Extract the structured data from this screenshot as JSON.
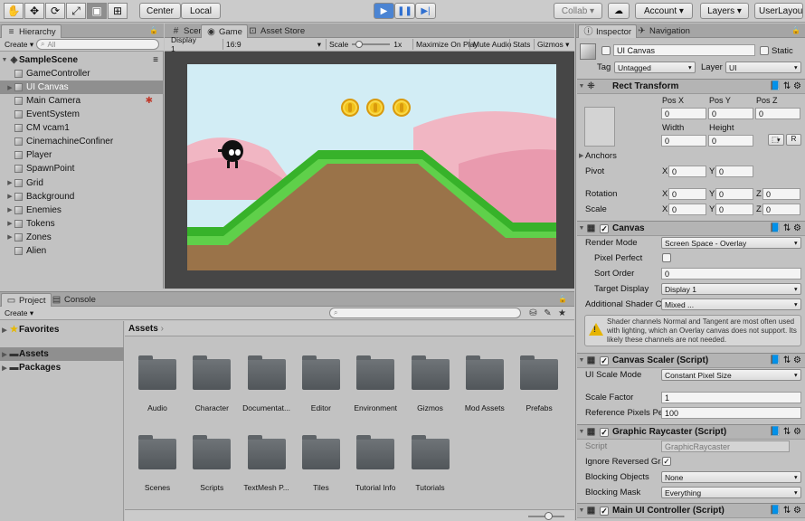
{
  "toolbar": {
    "tools": [
      "hand-icon",
      "move-icon",
      "rotate-icon",
      "scale-icon",
      "rect-tool-icon",
      "transform-icon"
    ],
    "pivot_label": "Center",
    "space_label": "Local",
    "play_icon": "play-icon",
    "pause_icon": "pause-icon",
    "step_icon": "step-icon",
    "collab_label": "Collab",
    "cloud_icon": "cloud-icon",
    "account_label": "Account",
    "layers_label": "Layers",
    "layout_label": "UserLayou"
  },
  "hierarchy": {
    "tab_label": "Hierarchy",
    "create_label": "Create",
    "search_placeholder": "All",
    "scene_name": "SampleScene",
    "items": [
      {
        "label": "GameController"
      },
      {
        "label": "UI Canvas"
      },
      {
        "label": "Main Camera"
      },
      {
        "label": "EventSystem"
      },
      {
        "label": "CM vcam1"
      },
      {
        "label": "CinemachineConfiner"
      },
      {
        "label": "Player"
      },
      {
        "label": "SpawnPoint"
      },
      {
        "label": "Grid"
      },
      {
        "label": "Background"
      },
      {
        "label": "Enemies"
      },
      {
        "label": "Tokens"
      },
      {
        "label": "Zones"
      },
      {
        "label": "Alien"
      }
    ]
  },
  "game_view": {
    "tabs": [
      "Scene",
      "Game",
      "Asset Store"
    ],
    "display_label": "Display 1",
    "aspect_label": "16:9",
    "scale_label": "Scale",
    "scale_value": "1x",
    "maximize_label": "Maximize On Play",
    "mute_label": "Mute Audio",
    "stats_label": "Stats",
    "gizmos_label": "Gizmos"
  },
  "project": {
    "tabs": [
      "Project",
      "Console"
    ],
    "create_label": "Create",
    "favorites_label": "Favorites",
    "assets_label": "Assets",
    "packages_label": "Packages",
    "breadcrumb": "Assets",
    "folders": [
      "Audio",
      "Character",
      "Documentat...",
      "Editor",
      "Environment",
      "Gizmos",
      "Mod Assets",
      "Prefabs",
      "Scenes",
      "Scripts",
      "TextMesh P...",
      "Tiles",
      "Tutorial Info",
      "Tutorials"
    ]
  },
  "inspector": {
    "tabs": [
      "Inspector",
      "Navigation"
    ],
    "object_name": "UI Canvas",
    "static_label": "Static",
    "tag_label": "Tag",
    "tag_value": "Untagged",
    "layer_label": "Layer",
    "layer_value": "UI",
    "rect_transform": {
      "title": "Rect Transform",
      "posx_label": "Pos X",
      "posy_label": "Pos Y",
      "posz_label": "Pos Z",
      "posx": "0",
      "posy": "0",
      "posz": "0",
      "width_label": "Width",
      "height_label": "Height",
      "width": "0",
      "height": "0",
      "r_label": "R",
      "anchors_label": "Anchors",
      "pivot_label": "Pivot",
      "pivot_x": "0",
      "pivot_y": "0",
      "rotation_label": "Rotation",
      "rot_x": "0",
      "rot_y": "0",
      "rot_z": "0",
      "scale_label": "Scale",
      "scale_x": "0",
      "scale_y": "0",
      "scale_z": "0"
    },
    "canvas": {
      "title": "Canvas",
      "render_mode_label": "Render Mode",
      "render_mode": "Screen Space - Overlay",
      "pixel_perfect_label": "Pixel Perfect",
      "sort_order_label": "Sort Order",
      "sort_order": "0",
      "target_display_label": "Target Display",
      "target_display": "Display 1",
      "shader_label": "Additional Shader Cl",
      "shader_value": "Mixed ...",
      "warning": "Shader channels Normal and Tangent are most often used with lighting, which an Overlay canvas does not support. Its likely these channels are not needed."
    },
    "scaler": {
      "title": "Canvas Scaler (Script)",
      "mode_label": "UI Scale Mode",
      "mode": "Constant Pixel Size",
      "factor_label": "Scale Factor",
      "factor": "1",
      "ref_label": "Reference Pixels Per",
      "ref": "100"
    },
    "raycaster": {
      "title": "Graphic Raycaster (Script)",
      "script_label": "Script",
      "script": "GraphicRaycaster",
      "ignore_label": "Ignore Reversed Gra",
      "blocking_objects_label": "Blocking Objects",
      "blocking_objects": "None",
      "blocking_mask_label": "Blocking Mask",
      "blocking_mask": "Everything"
    },
    "controller": {
      "title": "Main UI Controller (Script)"
    }
  }
}
